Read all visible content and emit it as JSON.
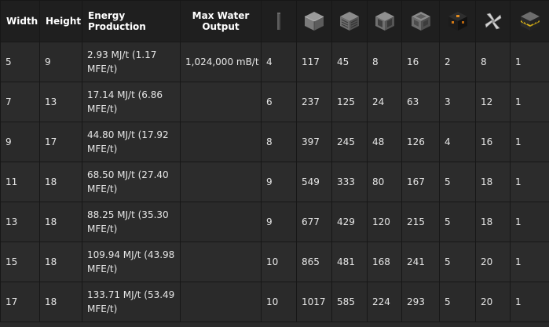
{
  "headers": {
    "width": "Width",
    "height": "Height",
    "energy": "Energy Production",
    "water": "Max Water Output"
  },
  "icon_columns": [
    "rod-icon",
    "casing-block-icon",
    "vent-block-icon",
    "glass-block-icon",
    "frame-block-icon",
    "coil-block-icon",
    "rotor-blade-icon",
    "hazard-block-icon"
  ],
  "rows": [
    {
      "width": "5",
      "height": "9",
      "energy": "2.93 MJ/t (1.17 MFE/t)",
      "water": "1,024,000 mB/t",
      "c": [
        "4",
        "117",
        "45",
        "8",
        "16",
        "2",
        "8",
        "1"
      ]
    },
    {
      "width": "7",
      "height": "13",
      "energy": "17.14 MJ/t (6.86 MFE/t)",
      "water": "",
      "c": [
        "6",
        "237",
        "125",
        "24",
        "63",
        "3",
        "12",
        "1"
      ]
    },
    {
      "width": "9",
      "height": "17",
      "energy": "44.80 MJ/t (17.92 MFE/t)",
      "water": "",
      "c": [
        "8",
        "397",
        "245",
        "48",
        "126",
        "4",
        "16",
        "1"
      ]
    },
    {
      "width": "11",
      "height": "18",
      "energy": "68.50 MJ/t (27.40 MFE/t)",
      "water": "",
      "c": [
        "9",
        "549",
        "333",
        "80",
        "167",
        "5",
        "18",
        "1"
      ]
    },
    {
      "width": "13",
      "height": "18",
      "energy": "88.25 MJ/t (35.30 MFE/t)",
      "water": "",
      "c": [
        "9",
        "677",
        "429",
        "120",
        "215",
        "5",
        "18",
        "1"
      ]
    },
    {
      "width": "15",
      "height": "18",
      "energy": "109.94 MJ/t (43.98 MFE/t)",
      "water": "",
      "c": [
        "10",
        "865",
        "481",
        "168",
        "241",
        "5",
        "20",
        "1"
      ]
    },
    {
      "width": "17",
      "height": "18",
      "energy": "133.71 MJ/t (53.49 MFE/t)",
      "water": "",
      "c": [
        "10",
        "1017",
        "585",
        "224",
        "293",
        "5",
        "20",
        "1"
      ]
    }
  ]
}
